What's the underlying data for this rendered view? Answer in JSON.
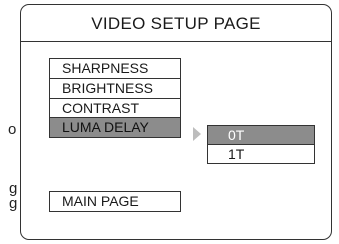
{
  "page_title": "VIDEO SETUP PAGE",
  "menu": {
    "items": [
      {
        "label": "SHARPNESS"
      },
      {
        "label": "BRIGHTNESS"
      },
      {
        "label": "CONTRAST"
      },
      {
        "label": "LUMA DELAY",
        "selected": true
      }
    ]
  },
  "submenu": {
    "options": [
      {
        "label": "0T",
        "selected": true
      },
      {
        "label": "1T"
      }
    ]
  },
  "main_page_label": "MAIN PAGE",
  "left_edge_fragments": [
    "o",
    "g",
    "g"
  ],
  "colors": {
    "selected_bg": "#8c8c8c",
    "border": "#333333",
    "arrow": "#bdbdbd"
  }
}
